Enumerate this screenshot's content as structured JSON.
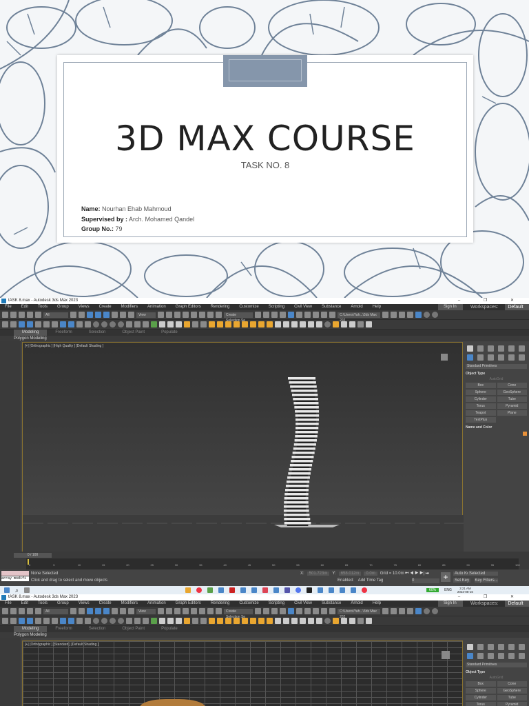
{
  "slide": {
    "title": "3D MAX COURSE",
    "subtitle": "TASK NO. 8",
    "name_label": "Name:",
    "name": "Nourhan Ehab Mahmoud",
    "supervised_label": "Supervised by :",
    "supervisor": "Arch. Mohamed Qandel",
    "group_label": "Group No.:",
    "group": "79",
    "accent": "#8596ab"
  },
  "app": {
    "window_title": "tASK 8.max - Autodesk 3ds Max 2023",
    "window_controls": "– ❐ ✕",
    "menu": [
      "File",
      "Edit",
      "Tools",
      "Group",
      "Views",
      "Create",
      "Modifiers",
      "Animation",
      "Graph Editors",
      "Rendering",
      "Customize",
      "Scripting",
      "Civil View",
      "Substance",
      "Arnold",
      "Help"
    ],
    "sign_in": "Sign In",
    "workspaces_label": "Workspaces:",
    "workspace": "Default",
    "selection_filter": "All",
    "ref_coord": "View",
    "named_selection": "Create Selection Se",
    "project_path": "C:\\Users\\Yah...\\3ds Max 202",
    "ribbon_tabs": [
      "Modeling",
      "Freeform",
      "Selection",
      "Object Paint",
      "Populate"
    ],
    "polygon_modeling": "Polygon Modeling",
    "viewport1_label": "[+] [Orthographic ] [High Quality ] [Default Shading ]",
    "viewport2_label": "[+] [Orthographic ] [Standard ] [Default Shading ]",
    "command_panel": {
      "category": "Standard Primitives",
      "object_type": "Object Type",
      "autogrid": "AutoGrid",
      "primitives": [
        "Box",
        "Cone",
        "Sphere",
        "GeoSphere",
        "Cylinder",
        "Tube",
        "Torus",
        "Pyramid",
        "Teapot",
        "Plane",
        "TextPlus"
      ],
      "name_and_color": "Name and Color",
      "color": "#e8913a"
    },
    "timeline": {
      "frame": "0 / 100",
      "ticks": [
        "0",
        "5",
        "10",
        "15",
        "20",
        "25",
        "30",
        "35",
        "40",
        "45",
        "50",
        "55",
        "60",
        "65",
        "70",
        "75",
        "80",
        "85",
        "90",
        "95",
        "100"
      ]
    },
    "status": {
      "maxscript": "array modifi",
      "selection": "None Selected",
      "prompt": "Click and drag to select and move objects",
      "x_label": "X:",
      "x": "501.723m",
      "y_label": "Y:",
      "y": "658.012m",
      "z": "0.0m",
      "grid": "Grid = 10.0m",
      "enabled": "Enabled:",
      "add_time_tag": "Add Time Tag",
      "frame_value": "0",
      "auto_key": "Auto Key",
      "selected": "Selected",
      "set_key": "Set Key",
      "key_filters": "Key Filters..."
    },
    "taskbar": {
      "battery": "60%",
      "lang": "ENG",
      "time": "3:21 AM",
      "date": "2023-08-16"
    }
  }
}
